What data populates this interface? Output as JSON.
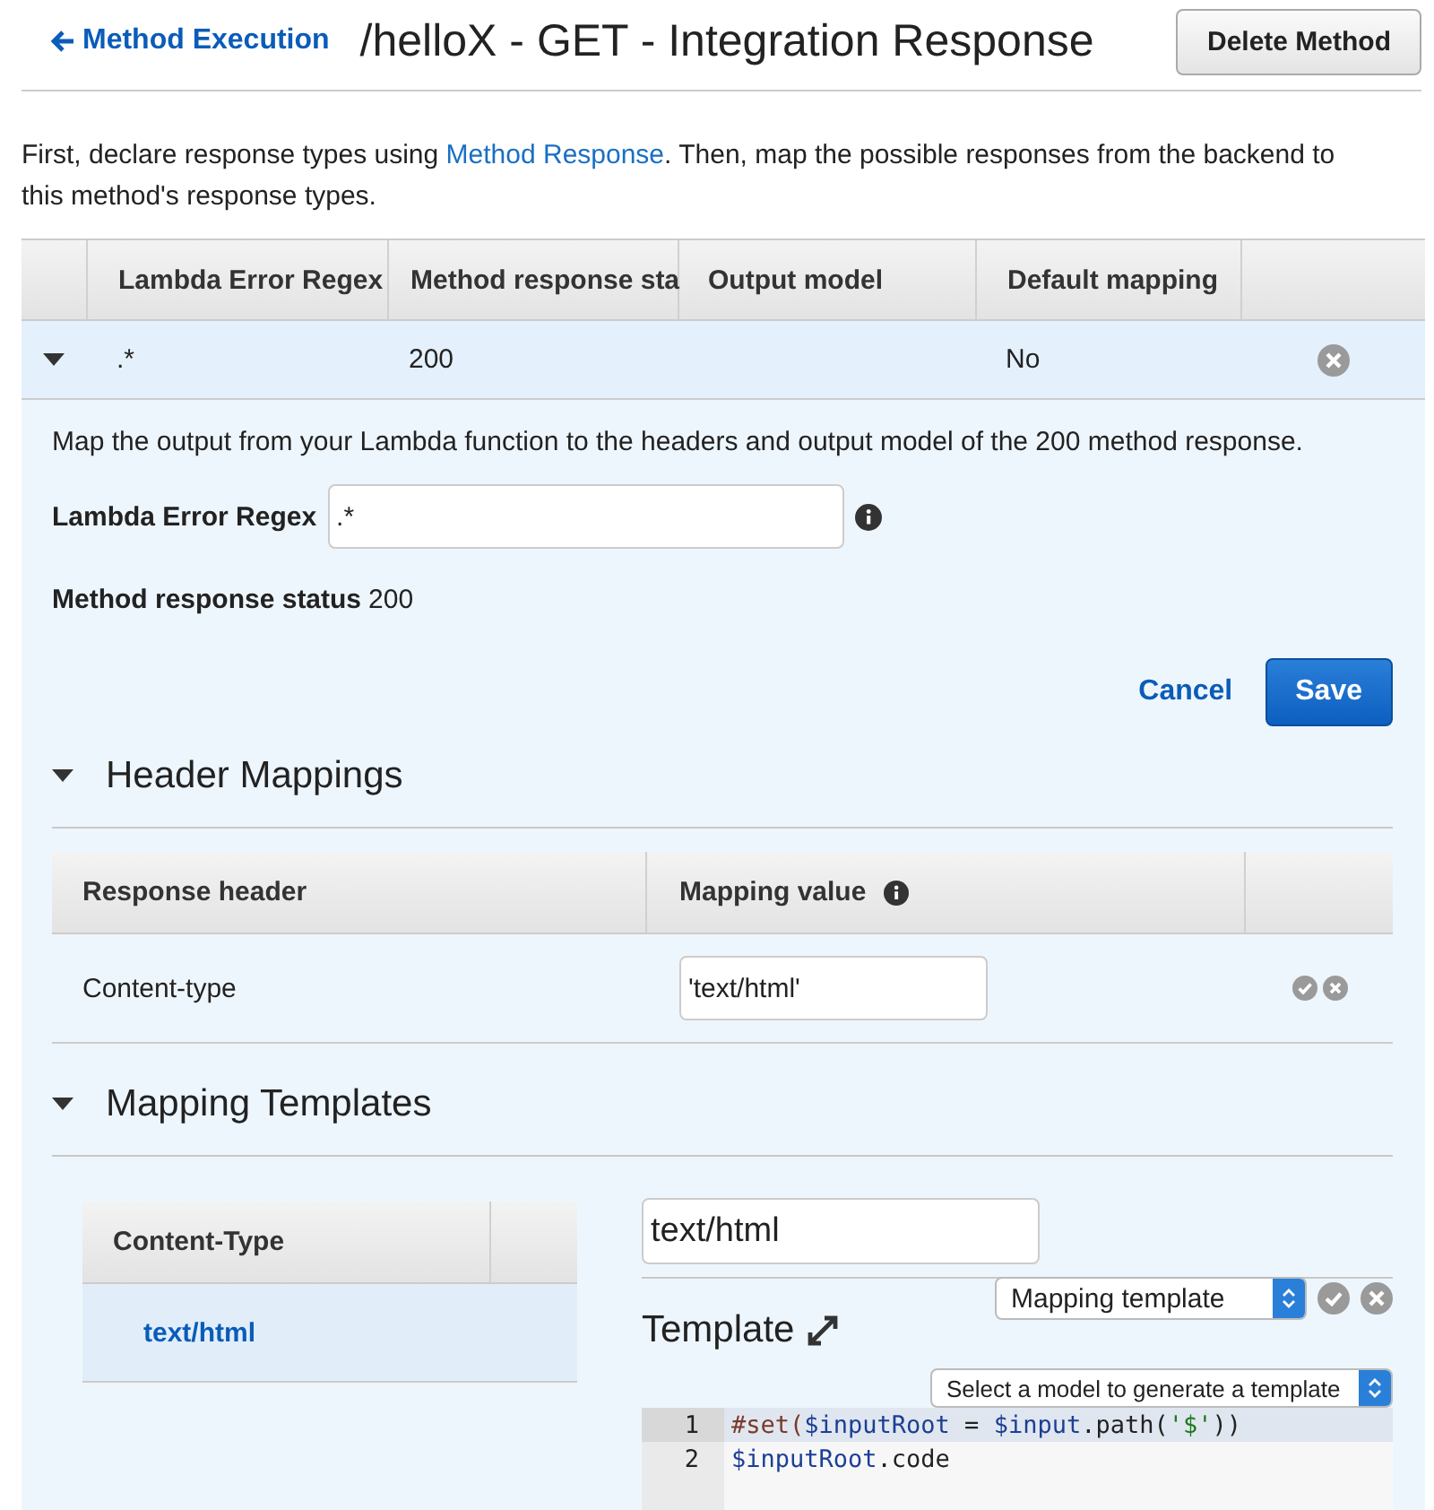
{
  "header": {
    "back_link": "Method Execution",
    "title": "/helloX - GET - Integration Response",
    "delete_button": "Delete Method"
  },
  "intro": {
    "before": "First, declare response types using ",
    "link": "Method Response",
    "after": ". Then, map the possible responses from the backend to this method's response types."
  },
  "responses_table": {
    "columns": [
      "Lambda Error Regex",
      "Method response sta",
      "Output model",
      "Default mapping"
    ],
    "rows": [
      {
        "expanded": true,
        "regex": ".*",
        "status": "200",
        "output_model": "",
        "default_mapping": "No"
      }
    ]
  },
  "detail": {
    "description": "Map the output from your Lambda function to the headers and output model of the 200 method response.",
    "regex_label": "Lambda Error Regex",
    "regex_value": ".*",
    "status_label": "Method response status",
    "status_value": "200",
    "cancel": "Cancel",
    "save": "Save"
  },
  "header_mappings": {
    "title": "Header Mappings",
    "expanded": true,
    "columns": [
      "Response header",
      "Mapping value"
    ],
    "rows": [
      {
        "header": "Content-type",
        "value": "'text/html'"
      }
    ]
  },
  "mapping_templates": {
    "title": "Mapping Templates",
    "expanded": true,
    "column": "Content-Type",
    "items": [
      {
        "label": "text/html",
        "selected": true
      }
    ],
    "content_type_value": "text/html",
    "template_title": "Template",
    "template_select": "Mapping template",
    "model_select": "Select a model to generate a template",
    "code_lines": [
      {
        "number": "1",
        "tokens": [
          {
            "kind": "directive",
            "text": "#set("
          },
          {
            "kind": "variable",
            "text": "$inputRoot"
          },
          {
            "kind": "plain",
            "text": " = "
          },
          {
            "kind": "variable",
            "text": "$input"
          },
          {
            "kind": "plain",
            "text": ".path("
          },
          {
            "kind": "string",
            "text": "'$'"
          },
          {
            "kind": "plain",
            "text": "))"
          }
        ]
      },
      {
        "number": "2",
        "tokens": [
          {
            "kind": "variable",
            "text": "$inputRoot"
          },
          {
            "kind": "plain",
            "text": ".code"
          }
        ]
      }
    ]
  }
}
